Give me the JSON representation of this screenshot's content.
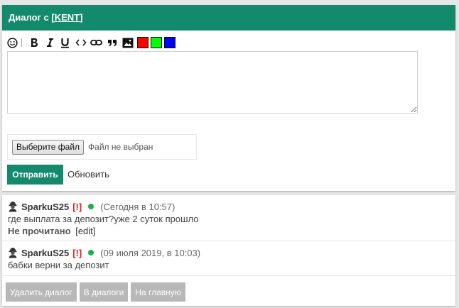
{
  "header": {
    "title_prefix": "Диалог с ",
    "bracket_open": "[",
    "user_link": "KENT",
    "bracket_close": "]"
  },
  "toolbar": {
    "buttons": [
      "smile-icon",
      "bold-icon",
      "italic-icon",
      "underline-icon",
      "code-icon",
      "link-icon",
      "quote-icon",
      "image-icon"
    ],
    "colors": [
      "#ff0000",
      "#00ff00",
      "#0000ff"
    ]
  },
  "editor": {
    "value": "",
    "placeholder": ""
  },
  "file": {
    "button_label": "Выберите файл",
    "status": "Файл не выбран"
  },
  "form": {
    "send_label": "Отправить",
    "refresh_label": "Обновить"
  },
  "messages": [
    {
      "author": "SparkuS25",
      "report": "[!]",
      "time": "(Сегодня в 10:57)",
      "text": "где выплата за депозит?уже 2 суток прошло",
      "status": "Не прочитано",
      "edit": "[edit]"
    },
    {
      "author": "SparkuS25",
      "report": "[!]",
      "time": "(09 июля 2019, в 10:03)",
      "text": "бабки верни за депозит"
    }
  ],
  "actions": {
    "delete": "Удалить диалог",
    "dialogs": "В диалоги",
    "home": "На главную"
  },
  "colors": {
    "brand": "#138a6b",
    "online": "#12b34a",
    "report": "#e02020",
    "button_gray": "#b8b8b8"
  }
}
